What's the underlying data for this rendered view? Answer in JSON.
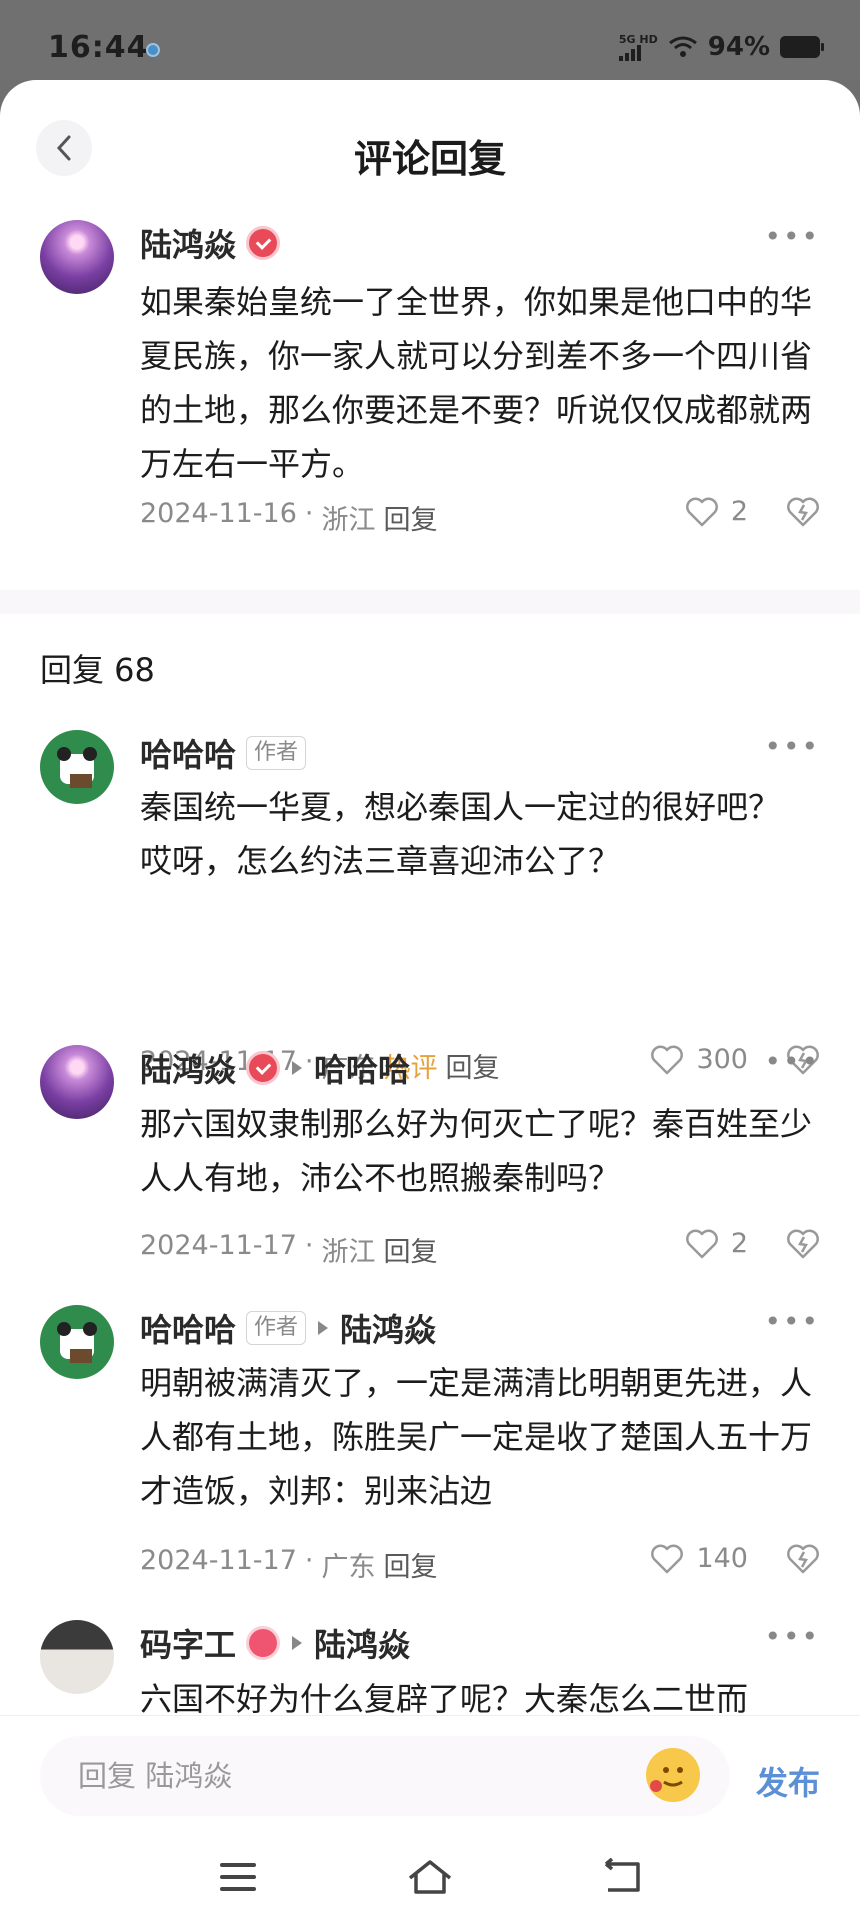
{
  "status": {
    "time": "16:44",
    "network": "5G HD",
    "battery": "94%"
  },
  "header": {
    "title": "评论回复"
  },
  "main_comment": {
    "author": "陆鸿焱",
    "text": "如果秦始皇统一了全世界，你如果是他口中的华夏民族，你一家人就可以分到差不多一个四川省的土地，那么你要还是不要？听说仅仅成都就两万左右一平方。",
    "date": "2024-11-16",
    "location": "浙江",
    "reply_label": "回复",
    "likes": "2"
  },
  "reply_count_label": "回复 68",
  "replies": [
    {
      "author": "哈哈哈",
      "tag": "作者",
      "text_lines": [
        "秦国统一华夏，想必秦国人一定过的很好吧？",
        "哎呀，怎么约法三章喜迎沛公了？"
      ],
      "date": "2024-11-17",
      "location": "广东",
      "hot": "热评",
      "reply_label": "回复",
      "likes": "300"
    },
    {
      "author": "陆鸿焱",
      "reply_to": "哈哈哈",
      "text": "那六国奴隶制那么好为何灭亡了呢？秦百姓至少人人有地，沛公不也照搬秦制吗？",
      "date": "2024-11-17",
      "location": "浙江",
      "reply_label": "回复",
      "likes": "2"
    },
    {
      "author": "哈哈哈",
      "tag": "作者",
      "reply_to": "陆鸿焱",
      "text": "明朝被满清灭了，一定是满清比明朝更先进，人人都有土地，陈胜吴广一定是收了楚国人五十万才造饭，刘邦：别来沾边",
      "date": "2024-11-17",
      "location": "广东",
      "reply_label": "回复",
      "likes": "140"
    },
    {
      "author": "码字工",
      "reply_to": "陆鸿焱",
      "text": "六国不好为什么复辟了呢？大秦怎么二世而"
    }
  ],
  "input": {
    "placeholder": "回复 陆鸿焱",
    "publish_label": "发布"
  },
  "icons": [
    "back-icon",
    "more-icon",
    "heart-icon",
    "dislike-icon",
    "emoji-icon",
    "menu-icon",
    "home-icon",
    "return-icon"
  ]
}
